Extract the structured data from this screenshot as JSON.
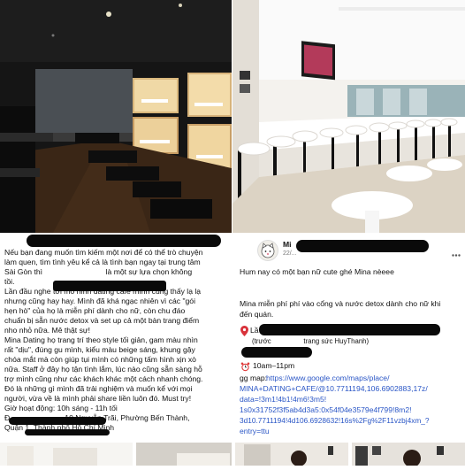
{
  "post_left": {
    "lines": [
      "Nếu bạn đang muốn tìm kiếm một nơi để có thể trò chuyện",
      "làm quen, tìm tình yêu kể cả là tình bạn ngay tại trung tâm",
      "Sài Gòn thì                              là một sự lựa chọn không",
      "tồi.",
      "Lần đầu nghe tới mô hình dating cafe mình cũng thấy lạ lạ",
      "nhưng cũng hay hay. Mình đã khá ngạc nhiên vì các \"gói",
      "hẹn hò\" của họ là miễn phí dành cho nữ, còn chu đáo",
      "chuẩn bị sẵn nước detox và set up cả một bàn trang điểm",
      "nho nhỏ nữa. Mê thật sự!",
      "Mina Dating họ trang trí theo style tối giản, gam màu nhìn",
      "rất \"dịu\", đúng gu mình, kiểu màu beige sáng, khung gậy",
      "chóa mắt mà còn giúp tụi mình có những tấm hình xịn xò",
      "nữa. Staff ở đây họ tận tình lắm, lúc nào cũng sẵn sàng hỗ",
      "trợ mình cũng như các khách khác một cách nhanh chóng.",
      "Đó là những gì mình đã trải nghiệm và muốn kể với mọi",
      "người, vừa về là mình phải share liền luôn đó. Must try!",
      "Giờ hoạt động: 10h sáng - 11h tối",
      "Đ                          10 Nguyễn Trãi, Phường Bến Thành,",
      "Quận 1, Thành phố Hồ Chí Minh"
    ]
  },
  "post_right": {
    "author": "Mi",
    "date": "22/...",
    "greeting": "Hum nay có một bạn nữ cute ghé Mina nèeee",
    "body_1": "Mina miễn phí phí vào cổng và nước detox dành cho nữ khi",
    "body_2": "đến quán.",
    "address_prefix": "Lầ",
    "address_paren": "(trước                 trang sức HuyThanh)",
    "hours": "10am–11pm",
    "map_label": "gg map:",
    "map_url_1": "https://www.google.com/maps/place/",
    "map_url_2": "MINA+DATING+CAFE/@10.7711194,106.6902883,17z/",
    "map_url_3": "data=!3m1!4b1!4m6!3m5!",
    "map_url_4": "1s0x31752f3f5ab4d3a5:0x54f04e3579e4f799!8m2!",
    "map_url_5": "3d10.7711194!4d106.6928632!16s%2Fg%2F11vzbj4xm_?",
    "map_url_6": "entry=ttu"
  },
  "icons": {
    "pin": "pin-icon",
    "clock": "alarm-clock-icon",
    "avatar": "cat-avatar-icon"
  },
  "colors": {
    "link": "#2a56c6",
    "redaction": "#0a0a0a",
    "text": "#111111",
    "cafe_dark": "#171717",
    "cafe_light": "#f2f0ec"
  }
}
